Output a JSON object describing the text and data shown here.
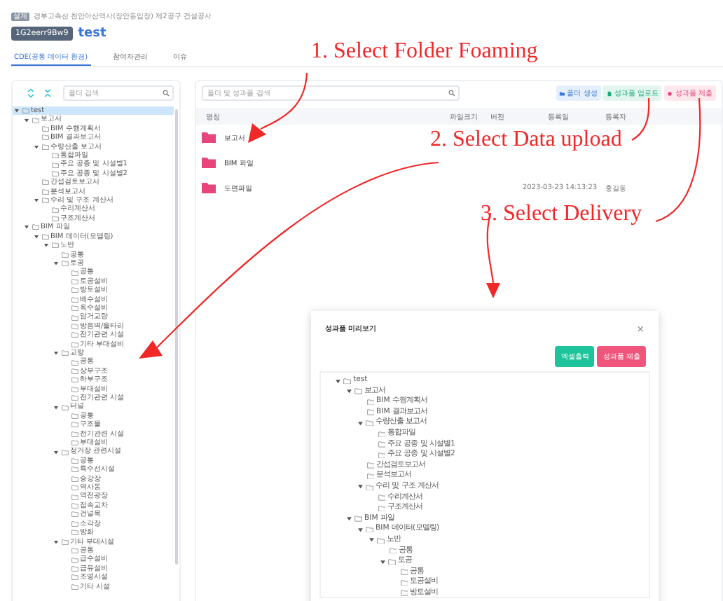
{
  "header": {
    "tag": "설계",
    "breadcrumb": "경부고속선 천안아산역사(장안동입장) 제2공구 건설공사",
    "project_code": "1G2eerr9Bw9",
    "title": "test"
  },
  "tabs": [
    {
      "label": "CDE(공통 데이터 환경)",
      "selected": true
    },
    {
      "label": "참여자관리",
      "selected": false
    },
    {
      "label": "이슈",
      "selected": false
    }
  ],
  "folder_panel": {
    "search": {
      "placeholder": "폴더 검색"
    },
    "tree": [
      {
        "label": "test",
        "expanded": true,
        "selected": true,
        "children": [
          {
            "label": "보고서",
            "expanded": true,
            "selected": false,
            "children": [
              {
                "label": "BIM 수행계획서",
                "selected": false
              },
              {
                "label": "BIM 결과보고서",
                "selected": false
              },
              {
                "label": "수량산출 보고서",
                "expanded": true,
                "selected": false,
                "children": [
                  {
                    "label": "통합파일",
                    "selected": false
                  },
                  {
                    "label": "주요 공종 및 시설별1",
                    "selected": false
                  },
                  {
                    "label": "주요 공종 및 시설별2",
                    "selected": false
                  }
                ]
              },
              {
                "label": "간섭검토보고서",
                "selected": false
              },
              {
                "label": "분석보고서",
                "selected": false
              },
              {
                "label": "수리 및 구조 계산서",
                "expanded": true,
                "selected": false,
                "children": [
                  {
                    "label": "수리계산서",
                    "selected": false
                  },
                  {
                    "label": "구조계산서",
                    "selected": false
                  }
                ]
              }
            ]
          },
          {
            "label": "BIM 파일",
            "expanded": true,
            "selected": false,
            "children": [
              {
                "label": "BIM 데이터(모델링)",
                "expanded": true,
                "selected": false,
                "children": [
                  {
                    "label": "노반",
                    "expanded": true,
                    "selected": false,
                    "children": [
                      {
                        "label": "공통",
                        "selected": false
                      },
                      {
                        "label": "토공",
                        "expanded": true,
                        "selected": false,
                        "children": [
                          {
                            "label": "공통",
                            "selected": false
                          },
                          {
                            "label": "토공설비",
                            "selected": false
                          },
                          {
                            "label": "방토설비",
                            "selected": false
                          },
                          {
                            "label": "배수설비",
                            "selected": false
                          },
                          {
                            "label": "옥수설비",
                            "selected": false
                          },
                          {
                            "label": "암거교량",
                            "selected": false
                          },
                          {
                            "label": "방음벽/울타리",
                            "selected": false
                          },
                          {
                            "label": "전기관련 시설",
                            "selected": false
                          },
                          {
                            "label": "기타 부대설비",
                            "selected": false
                          }
                        ]
                      },
                      {
                        "label": "교량",
                        "expanded": true,
                        "selected": false,
                        "children": [
                          {
                            "label": "공통",
                            "selected": false
                          },
                          {
                            "label": "상부구조",
                            "selected": false
                          },
                          {
                            "label": "하부구조",
                            "selected": false
                          },
                          {
                            "label": "부대설비",
                            "selected": false
                          },
                          {
                            "label": "전기관련 시설",
                            "selected": false
                          }
                        ]
                      },
                      {
                        "label": "터널",
                        "expanded": true,
                        "selected": false,
                        "children": [
                          {
                            "label": "공통",
                            "selected": false
                          },
                          {
                            "label": "구조물",
                            "selected": false
                          },
                          {
                            "label": "전기관련 시설",
                            "selected": false
                          },
                          {
                            "label": "부대설비",
                            "selected": false
                          }
                        ]
                      },
                      {
                        "label": "정거장 관련시설",
                        "expanded": true,
                        "selected": false,
                        "children": [
                          {
                            "label": "공통",
                            "selected": false
                          },
                          {
                            "label": "특수선시설",
                            "selected": false
                          },
                          {
                            "label": "승강장",
                            "selected": false
                          },
                          {
                            "label": "역사동",
                            "selected": false
                          },
                          {
                            "label": "역전광장",
                            "selected": false
                          },
                          {
                            "label": "접속교차",
                            "selected": false
                          },
                          {
                            "label": "건널목",
                            "selected": false
                          },
                          {
                            "label": "소각장",
                            "selected": false
                          },
                          {
                            "label": "방화",
                            "selected": false
                          }
                        ]
                      },
                      {
                        "label": "기타 부대시설",
                        "expanded": true,
                        "selected": false,
                        "children": [
                          {
                            "label": "공통",
                            "selected": false
                          },
                          {
                            "label": "급수설비",
                            "selected": false
                          },
                          {
                            "label": "급유설비",
                            "selected": false
                          },
                          {
                            "label": "조명시설",
                            "selected": false
                          },
                          {
                            "label": "기타 시설",
                            "selected": false
                          }
                        ]
                      }
                    ]
                  }
                ]
              }
            ]
          }
        ]
      }
    ]
  },
  "content": {
    "search": {
      "placeholder": "폴더 및 성과품 검색"
    },
    "buttons": [
      {
        "label": "폴더 생성",
        "kind": "primary"
      },
      {
        "label": "성과품 업로드",
        "kind": "success"
      },
      {
        "label": "성과품 제출",
        "kind": "danger"
      }
    ],
    "table": {
      "columns": [
        "명칭",
        "파일크기",
        "버전",
        "등록일",
        "등록자"
      ],
      "rows": [
        {
          "name": "보고서"
        },
        {
          "name": "BIM 파일"
        },
        {
          "name": "도면파일",
          "date": "2023-03-23 14:13:23",
          "user": "홍길동"
        }
      ]
    }
  },
  "dialog": {
    "title": "성과품 미리보기",
    "close": "×",
    "buttons": [
      {
        "label": "엑셀출력",
        "kind": "success"
      },
      {
        "label": "성과품 제출",
        "kind": "danger"
      }
    ],
    "tree": [
      {
        "label": "test",
        "expanded": true,
        "children": [
          {
            "label": "보고서",
            "expanded": true,
            "children": [
              {
                "label": "BIM 수행계획서"
              },
              {
                "label": "BIM 결과보고서"
              },
              {
                "label": "수량산출 보고서",
                "expanded": true,
                "children": [
                  {
                    "label": "통합파일"
                  },
                  {
                    "label": "주요 공종 및 시설별1"
                  },
                  {
                    "label": "주요 공종 및 시설별2"
                  }
                ]
              },
              {
                "label": "간섭검토보고서"
              },
              {
                "label": "분석보고서"
              },
              {
                "label": "수리 및 구조 계산서",
                "expanded": true,
                "children": [
                  {
                    "label": "수리계산서"
                  },
                  {
                    "label": "구조계산서"
                  }
                ]
              }
            ]
          },
          {
            "label": "BIM 파일",
            "expanded": true,
            "children": [
              {
                "label": "BIM 데이터(모델링)",
                "expanded": true,
                "children": [
                  {
                    "label": "노반",
                    "expanded": true,
                    "children": [
                      {
                        "label": "공통"
                      },
                      {
                        "label": "토공",
                        "expanded": true,
                        "children": [
                          {
                            "label": "공통"
                          },
                          {
                            "label": "토공설비"
                          },
                          {
                            "label": "방토설비"
                          }
                        ]
                      }
                    ]
                  }
                ]
              }
            ]
          }
        ]
      }
    ]
  },
  "annotations": [
    {
      "text": "1. Select Folder Foaming"
    },
    {
      "text": "2. Select Data upload"
    },
    {
      "text": "3. Select Delivery"
    }
  ]
}
